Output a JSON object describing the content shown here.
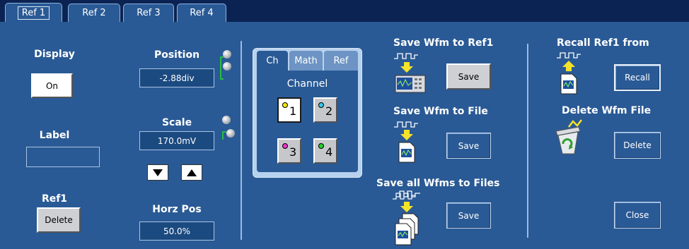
{
  "tabs": [
    {
      "label": "Ref 1",
      "active": true
    },
    {
      "label": "Ref 2",
      "active": false
    },
    {
      "label": "Ref 3",
      "active": false
    },
    {
      "label": "Ref 4",
      "active": false
    }
  ],
  "display": {
    "title": "Display",
    "button": "On"
  },
  "label_section": {
    "title": "Label",
    "value": ""
  },
  "ref1": {
    "title": "Ref1",
    "button": "Delete"
  },
  "position": {
    "title": "Position",
    "value": "-2.88div"
  },
  "scale": {
    "title": "Scale",
    "value": "170.0mV"
  },
  "horz_pos": {
    "title": "Horz Pos",
    "value": "50.0%"
  },
  "source": {
    "tabs": [
      "Ch",
      "Math",
      "Ref"
    ],
    "active_tab": "Ch",
    "heading": "Channel",
    "channels": [
      {
        "num": "1",
        "color": "#f2e600",
        "selected": true
      },
      {
        "num": "2",
        "color": "#37c8ec",
        "selected": false
      },
      {
        "num": "3",
        "color": "#ee33cc",
        "selected": false
      },
      {
        "num": "4",
        "color": "#22d12c",
        "selected": false
      }
    ]
  },
  "save_ref": {
    "title": "Save Wfm to Ref1",
    "button": "Save"
  },
  "save_file": {
    "title": "Save Wfm to File",
    "button": "Save"
  },
  "save_all": {
    "title": "Save all Wfms to Files",
    "button": "Save"
  },
  "recall": {
    "title": "Recall Ref1 from",
    "button": "Recall"
  },
  "delete_file": {
    "title": "Delete Wfm File",
    "button": "Delete"
  },
  "close": {
    "button": "Close"
  },
  "colors": {
    "panel": "#2a5a95",
    "tabbar": "#0b2352",
    "arrow": "#f5e22a"
  },
  "icons": [
    "waveform-icon",
    "down-arrow-icon",
    "up-arrow-icon",
    "oscilloscope-icon",
    "document-icon",
    "recycle-bin-icon",
    "multi-document-icon",
    "knob-icon"
  ]
}
